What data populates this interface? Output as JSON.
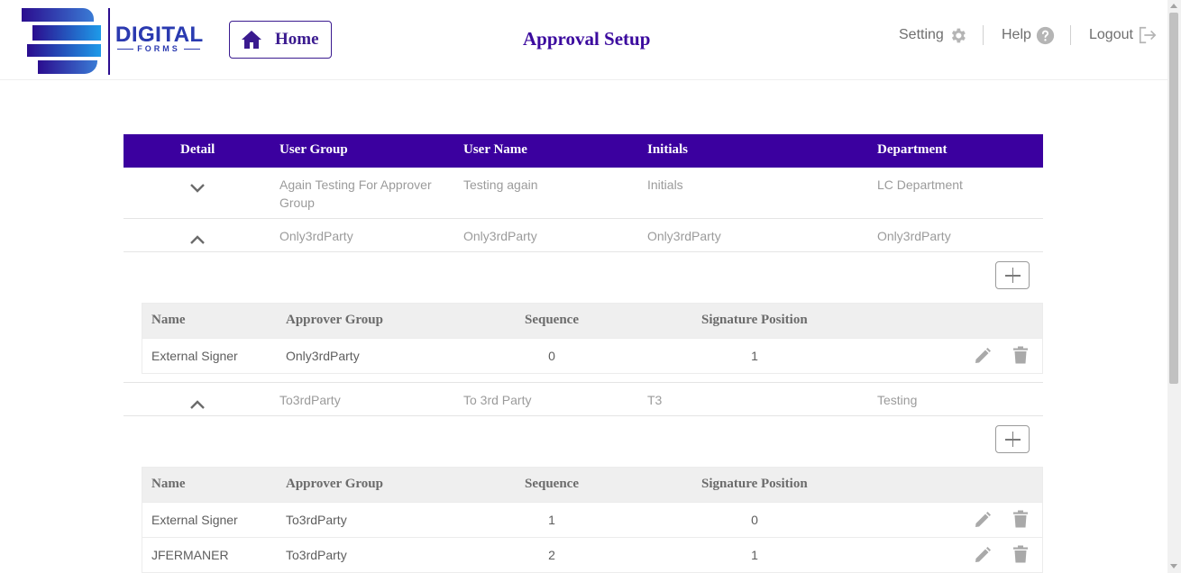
{
  "logo": {
    "brand": "DIGITAL",
    "sub": "FORMS"
  },
  "header": {
    "home_label": "Home",
    "title": "Approval Setup",
    "setting_label": "Setting",
    "help_label": "Help",
    "logout_label": "Logout"
  },
  "table": {
    "columns": [
      "Detail",
      "User Group",
      "User Name",
      "Initials",
      "Department"
    ],
    "rows": [
      {
        "user_group": "Again Testing For Approver Group",
        "user_name": "Testing again",
        "initials": "Initials",
        "department": "LC Department",
        "expanded": false
      },
      {
        "user_group": "Only3rdParty",
        "user_name": "Only3rdParty",
        "initials": "Only3rdParty",
        "department": "Only3rdParty",
        "expanded": true
      },
      {
        "user_group": "To3rdParty",
        "user_name": "To 3rd Party",
        "initials": "T3",
        "department": "Testing",
        "expanded": true
      }
    ]
  },
  "sub_table": {
    "columns": [
      "Name",
      "Approver Group",
      "Sequence",
      "Signature Position"
    ],
    "groups": [
      {
        "rows": [
          {
            "name": "External Signer",
            "approver_group": "Only3rdParty",
            "sequence": "0",
            "signature_position": "1"
          }
        ]
      },
      {
        "rows": [
          {
            "name": "External Signer",
            "approver_group": "To3rdParty",
            "sequence": "1",
            "signature_position": "0"
          },
          {
            "name": "JFERMANER",
            "approver_group": "To3rdParty",
            "sequence": "2",
            "signature_position": "1"
          }
        ]
      }
    ]
  },
  "colors": {
    "primary": "#3b009f",
    "title": "#3b0a9e",
    "muted_text": "#9b9b9b",
    "sub_header_bg": "#efefef"
  },
  "icons": [
    "home-icon",
    "gear-icon",
    "help-icon",
    "logout-icon",
    "chevron-down-icon",
    "chevron-up-icon",
    "plus-icon",
    "pencil-icon",
    "trash-icon"
  ]
}
